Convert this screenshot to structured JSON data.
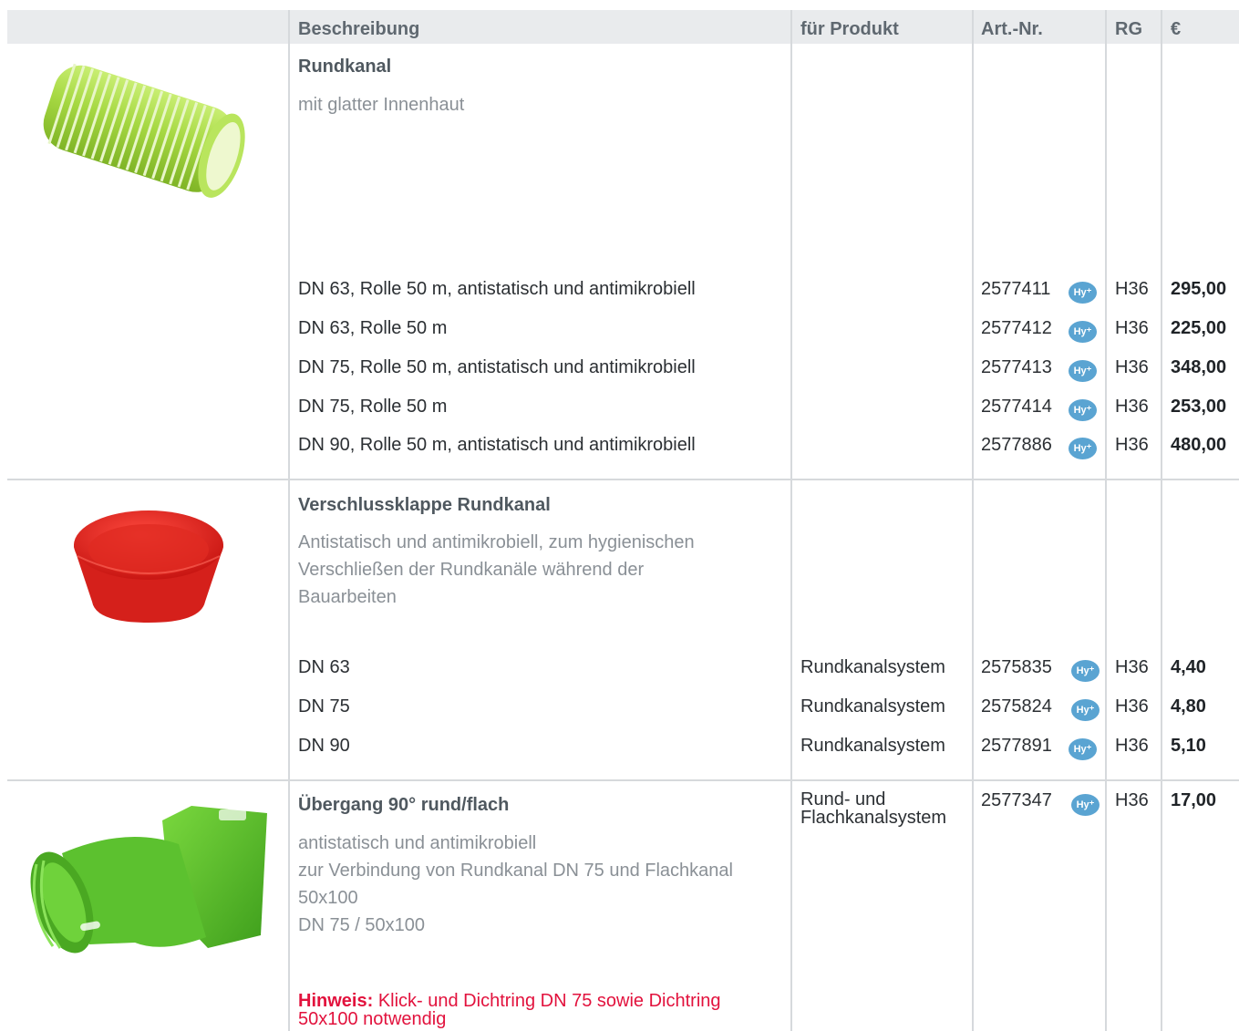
{
  "header": {
    "beschreibung": "Beschreibung",
    "fuer_produkt": "für Produkt",
    "art_nr": "Art.-Nr.",
    "rg": "RG",
    "price": "€"
  },
  "hy_badge": "Hy⁺",
  "sections": [
    {
      "title": "Rundkanal",
      "description": [
        "mit glatter Innenhaut"
      ],
      "image_icon": "green-corrugated-pipe",
      "rows": [
        {
          "desc": "DN 63, Rolle 50 m, antistatisch und antimikrobiell",
          "product": "",
          "art": "2577411",
          "rg": "H36",
          "price": "295,00"
        },
        {
          "desc": "DN 63, Rolle 50 m",
          "product": "",
          "art": "2577412",
          "rg": "H36",
          "price": "225,00"
        },
        {
          "desc": "DN 75, Rolle 50 m, antistatisch und antimikrobiell",
          "product": "",
          "art": "2577413",
          "rg": "H36",
          "price": "348,00"
        },
        {
          "desc": "DN 75, Rolle 50 m",
          "product": "",
          "art": "2577414",
          "rg": "H36",
          "price": "253,00"
        },
        {
          "desc": "DN 90, Rolle 50 m, antistatisch und antimikrobiell",
          "product": "",
          "art": "2577886",
          "rg": "H36",
          "price": "480,00"
        }
      ]
    },
    {
      "title": "Verschlussklappe Rundkanal",
      "description": [
        "Antistatisch und antimikrobiell, zum hygienischen",
        "Verschließen der Rundkanäle während der",
        "Bauarbeiten"
      ],
      "image_icon": "red-cap",
      "rows": [
        {
          "desc": "DN 63",
          "product": "Rundkanalsystem",
          "art": "2575835",
          "rg": "H36",
          "price": "4,40"
        },
        {
          "desc": "DN 75",
          "product": "Rundkanalsystem",
          "art": "2575824",
          "rg": "H36",
          "price": "4,80"
        },
        {
          "desc": "DN 90",
          "product": "Rundkanalsystem",
          "art": "2577891",
          "rg": "H36",
          "price": "5,10"
        }
      ]
    },
    {
      "title": "Übergang 90° rund/flach",
      "description": [
        "antistatisch und antimikrobiell",
        "zur Verbindung von Rundkanal DN 75 und Flachkanal",
        "50x100",
        "DN 75 / 50x100"
      ],
      "image_icon": "green-90-degree-adapter",
      "product_lines": [
        "Rund- und",
        "Flachkanalsystem"
      ],
      "art": "2577347",
      "rg": "H36",
      "price": "17,00",
      "note_label": "Hinweis:",
      "note_line1": "Klick- und Dichtring DN 75 sowie Dichtring",
      "note_line2": "50x100 notwendig"
    }
  ],
  "colors": {
    "header_bg": "#e9ebed",
    "grid": "#d6d9dc",
    "hy_badge": "#5aa4d2",
    "note": "#e2123d",
    "pipe_green": "#9ed03a",
    "cap_red": "#e8201d",
    "adapter_green": "#5cc12f"
  }
}
